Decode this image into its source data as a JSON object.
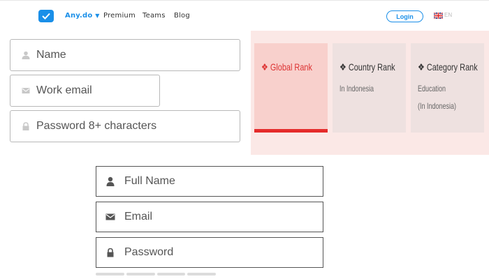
{
  "header": {
    "brand": "Any.do",
    "nav": [
      "Premium",
      "Teams",
      "Blog"
    ],
    "login": "Login",
    "lang": "EN",
    "accent": "#1a8fe8"
  },
  "signup_form": {
    "name_placeholder": "Name",
    "email_placeholder": "Work email",
    "password_placeholder": "Password 8+ characters",
    "icons": [
      "user-icon",
      "envelope-icon",
      "lock-icon"
    ]
  },
  "ranks": {
    "cards": [
      {
        "title": "Global Rank",
        "sub1": "",
        "sub2": "",
        "active": true
      },
      {
        "title": "Country Rank",
        "sub1": "In Indonesia",
        "sub2": "",
        "active": false
      },
      {
        "title": "Category Rank",
        "sub1": "Education",
        "sub2": "(In Indonesia)",
        "active": false
      }
    ],
    "active_color": "#e52b2b"
  },
  "register_form": {
    "fullname_placeholder": "Full Name",
    "email_placeholder": "Email",
    "password_placeholder": "Password"
  }
}
